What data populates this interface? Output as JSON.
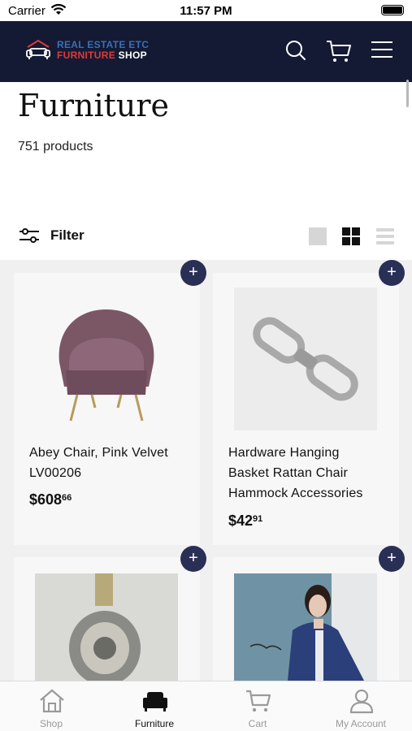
{
  "status_bar": {
    "carrier": "Carrier",
    "time": "11:57 PM"
  },
  "header": {
    "logo_line1": "REAL ESTATE ETC",
    "logo_line2_a": "FURNITURE",
    "logo_line2_b": "SHOP",
    "icons": [
      "search-icon",
      "cart-icon",
      "menu-icon"
    ]
  },
  "page": {
    "title": "Furniture",
    "product_count": "751 products"
  },
  "filter": {
    "label": "Filter",
    "icon": "sliders-icon",
    "view_options": [
      "single-view-icon",
      "grid-view-icon",
      "list-view-icon"
    ],
    "selected_view": "grid-view-icon"
  },
  "products": [
    {
      "title_line1": "Abey Chair, Pink Velvet",
      "title_line2": "LV00206",
      "title_line3": "",
      "price_main": "$608",
      "price_cents": "66",
      "image": "pink-velvet-chair"
    },
    {
      "title_line1": "Hardware Hanging",
      "title_line2": "Basket Rattan Chair",
      "title_line3": "Hammock Accessories",
      "price_main": "$42",
      "price_cents": "91",
      "image": "swivel-hook"
    },
    {
      "title_line1": "",
      "title_line2": "",
      "title_line3": "",
      "price_main": "",
      "price_cents": "",
      "image": "metal-part"
    },
    {
      "title_line1": "",
      "title_line2": "",
      "title_line3": "",
      "price_main": "",
      "price_cents": "",
      "image": "woman-blue-blanket"
    }
  ],
  "add_button": "+",
  "tabbar": {
    "tabs": [
      {
        "label": "Shop",
        "icon": "home-icon"
      },
      {
        "label": "Furniture",
        "icon": "armchair-icon"
      },
      {
        "label": "Cart",
        "icon": "cart-icon"
      },
      {
        "label": "My Account",
        "icon": "user-icon"
      }
    ],
    "active": "Furniture"
  },
  "colors": {
    "header_bg": "#141a33",
    "accent": "#2a2f55",
    "logo_blue": "#3b6fb6",
    "logo_red": "#e03a3a"
  }
}
